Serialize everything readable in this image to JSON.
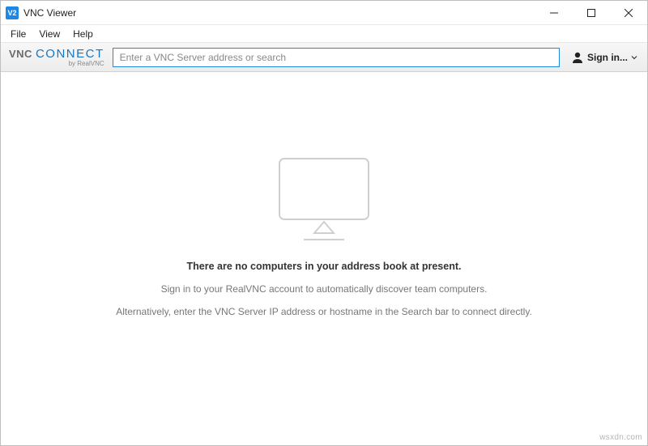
{
  "window": {
    "title": "VNC Viewer",
    "app_icon_text": "V2"
  },
  "menubar": {
    "file": "File",
    "view": "View",
    "help": "Help"
  },
  "toolbar": {
    "brand_vnc": "VNC",
    "brand_connect": "CONNECT",
    "brand_sub": "by RealVNC",
    "search_placeholder": "Enter a VNC Server address or search",
    "signin_label": "Sign in..."
  },
  "content": {
    "heading": "There are no computers in your address book at present.",
    "line1": "Sign in to your RealVNC account to automatically discover team computers.",
    "line2": "Alternatively, enter the VNC Server IP address or hostname in the Search bar to connect directly."
  },
  "watermark": "wsxdn.com"
}
